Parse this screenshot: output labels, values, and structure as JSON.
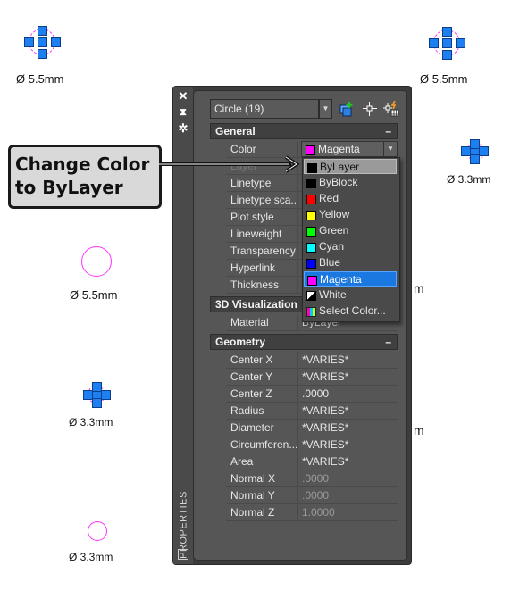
{
  "drawing": {
    "dimension_labels": [
      {
        "id": "top-left",
        "text": "Ø 5.5mm"
      },
      {
        "id": "top-right",
        "text": "Ø 5.5mm"
      },
      {
        "id": "right-small",
        "text": "Ø 3.3mm"
      },
      {
        "id": "left-mid",
        "text": "Ø 5.5mm"
      },
      {
        "id": "left-small",
        "text": "Ø 3.3mm"
      },
      {
        "id": "bottom-left",
        "text": "Ø 3.3mm"
      },
      {
        "id": "right-partial-1",
        "text": "m"
      },
      {
        "id": "right-partial-2",
        "text": "m"
      }
    ],
    "circle_color": "#ff33ff",
    "grip_color": "#1e7ff0"
  },
  "callout": {
    "line1": "Change Color",
    "line2": "to ByLayer"
  },
  "palette": {
    "title": "PROPERTIES",
    "strip_icons": [
      "close-icon",
      "auto-hide-icon",
      "settings-icon"
    ],
    "selector": {
      "value": "Circle (19)"
    },
    "toolbar": [
      "toggle-pickadd-icon",
      "select-objects-icon",
      "quick-select-icon"
    ],
    "sections": {
      "general": {
        "title": "General",
        "collapse": "–",
        "rows": [
          {
            "label": "Color",
            "value": "Magenta"
          },
          {
            "label": "Layer",
            "value": ""
          },
          {
            "label": "Linetype",
            "value": ""
          },
          {
            "label": "Linetype sca...",
            "value": ""
          },
          {
            "label": "Plot style",
            "value": ""
          },
          {
            "label": "Lineweight",
            "value": ""
          },
          {
            "label": "Transparency",
            "value": ""
          },
          {
            "label": "Hyperlink",
            "value": ""
          },
          {
            "label": "Thickness",
            "value": ""
          }
        ]
      },
      "viz3d": {
        "title": "3D Visualization",
        "rows": [
          {
            "label": "Material",
            "value": "ByLayer"
          }
        ]
      },
      "geometry": {
        "title": "Geometry",
        "collapse": "–",
        "rows": [
          {
            "label": "Center X",
            "value": "*VARIES*"
          },
          {
            "label": "Center Y",
            "value": "*VARIES*"
          },
          {
            "label": "Center Z",
            "value": ".0000"
          },
          {
            "label": "Radius",
            "value": "*VARIES*"
          },
          {
            "label": "Diameter",
            "value": "*VARIES*"
          },
          {
            "label": "Circumferen...",
            "value": "*VARIES*"
          },
          {
            "label": "Area",
            "value": "*VARIES*"
          },
          {
            "label": "Normal X",
            "value": ".0000"
          },
          {
            "label": "Normal Y",
            "value": ".0000"
          },
          {
            "label": "Normal Z",
            "value": "1.0000"
          }
        ]
      }
    },
    "color_combo": {
      "value": "Magenta",
      "swatch": "#ff00ff"
    },
    "color_options": [
      {
        "label": "ByLayer",
        "swatch": "#000000",
        "state": "hover"
      },
      {
        "label": "ByBlock",
        "swatch": "#000000",
        "state": ""
      },
      {
        "label": "Red",
        "swatch": "#ff0000",
        "state": ""
      },
      {
        "label": "Yellow",
        "swatch": "#ffff00",
        "state": ""
      },
      {
        "label": "Green",
        "swatch": "#00ff00",
        "state": ""
      },
      {
        "label": "Cyan",
        "swatch": "#00ffff",
        "state": ""
      },
      {
        "label": "Blue",
        "swatch": "#0000ff",
        "state": ""
      },
      {
        "label": "Magenta",
        "swatch": "#ff00ff",
        "state": "selected"
      },
      {
        "label": "White",
        "swatch": "white-black",
        "state": ""
      },
      {
        "label": "Select Color...",
        "swatch": "palette",
        "state": ""
      }
    ]
  }
}
